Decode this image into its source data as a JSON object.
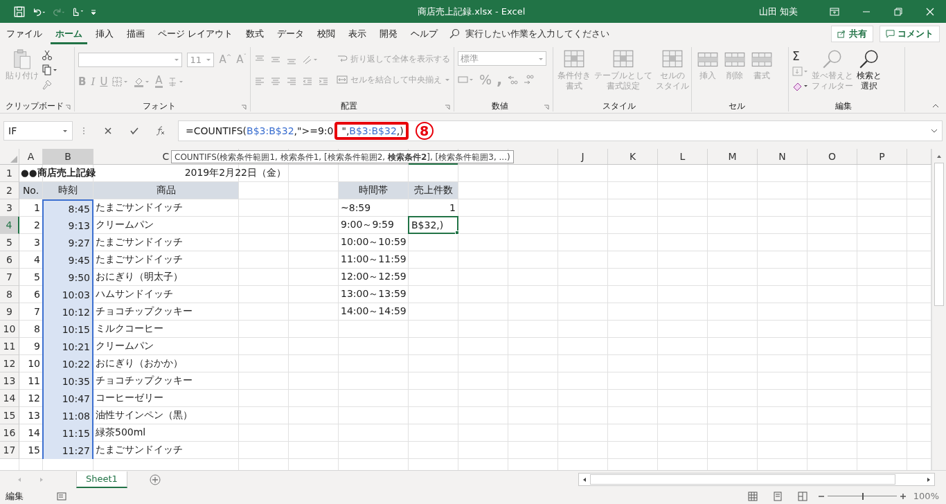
{
  "title_bar": {
    "title": "商店売上記録.xlsx  -  Excel",
    "user": "山田 知美"
  },
  "menu_tabs": [
    {
      "label": "ファイル",
      "selected": false
    },
    {
      "label": "ホーム",
      "selected": true
    },
    {
      "label": "挿入",
      "selected": false
    },
    {
      "label": "描画",
      "selected": false
    },
    {
      "label": "ページ レイアウト",
      "selected": false
    },
    {
      "label": "数式",
      "selected": false
    },
    {
      "label": "データ",
      "selected": false
    },
    {
      "label": "校閲",
      "selected": false
    },
    {
      "label": "表示",
      "selected": false
    },
    {
      "label": "開発",
      "selected": false
    },
    {
      "label": "ヘルプ",
      "selected": false
    }
  ],
  "tell_me": {
    "placeholder": "実行したい作業を入力してください"
  },
  "share_button": "共有",
  "comment_button": "コメント",
  "ribbon": {
    "clipboard": {
      "label": "クリップボード",
      "paste": {
        "label": "貼り付け",
        "disabled": true
      }
    },
    "font": {
      "label": "フォント",
      "font_size": "11",
      "size_buttons": [
        {
          "letter": "A",
          "arrow": "^"
        },
        {
          "letter": "A",
          "arrow": "ˇ"
        }
      ],
      "style_buttons": [
        "B",
        "I",
        "U"
      ],
      "color_button": "A"
    },
    "alignment": {
      "label": "配置",
      "wrap": "折り返して全体を表示する",
      "merge": "セルを結合して中央揃え"
    },
    "number": {
      "label": "数値",
      "format": "標準",
      "percent": "%",
      "comma": ","
    },
    "styles": {
      "label": "スタイル",
      "buttons": [
        {
          "lines": [
            "条件付き",
            "書式"
          ],
          "disabled": true
        },
        {
          "lines": [
            "テーブルとして",
            "書式設定"
          ],
          "disabled": true
        },
        {
          "lines": [
            "セルの",
            "スタイル"
          ],
          "disabled": true
        }
      ]
    },
    "cells": {
      "label": "セル",
      "buttons": [
        {
          "lines": [
            "挿入"
          ],
          "disabled": true
        },
        {
          "lines": [
            "削除"
          ],
          "disabled": true
        },
        {
          "lines": [
            "書式"
          ],
          "disabled": true
        }
      ]
    },
    "editing": {
      "label": "編集",
      "sum": "Σ",
      "buttons": [
        {
          "lines": [
            "並べ替えと",
            "フィルター"
          ],
          "disabled": true
        },
        {
          "lines": [
            "検索と",
            "選択"
          ],
          "disabled": false
        }
      ]
    }
  },
  "formula_bar": {
    "name_box": "IF",
    "segments": [
      {
        "text": "=COUNTIFS(",
        "kind": "plain"
      },
      {
        "text": "B$3:B$32",
        "kind": "ref"
      },
      {
        "text": ",\">=9:0",
        "kind": "plain"
      }
    ],
    "highlighted_segments": [
      {
        "text": "\",",
        "kind": "plain"
      },
      {
        "text": "B$3:B$32",
        "kind": "ref"
      },
      {
        "text": ",)",
        "kind": "plain"
      }
    ],
    "step_badge": "8"
  },
  "tooltip": "COUNTIFS(検索条件範囲1, 検索条件1, [検索条件範囲2, **検索条件2**], [検索条件範囲3, ...)",
  "column_headers": [
    "A",
    "B",
    "C",
    "J",
    "K",
    "L",
    "M",
    "N",
    "O",
    "P"
  ],
  "title_row": {
    "number": "1",
    "selected": false,
    "title": "●●商店売上記録",
    "date": "2019年2月22日（金）"
  },
  "rows": [
    {
      "number": "2",
      "kind": "header",
      "selected": false,
      "range": false,
      "g_active": false,
      "a": "No.",
      "b": "時刻",
      "c": "商品",
      "f": "時間帯",
      "g": "売上件数"
    },
    {
      "number": "3",
      "kind": "data",
      "selected": false,
      "range": true,
      "g_active": false,
      "a": "1",
      "b": "8:45",
      "c": "たまごサンドイッチ",
      "f": "~8:59",
      "g": "1"
    },
    {
      "number": "4",
      "kind": "data",
      "selected": true,
      "range": true,
      "g_active": true,
      "a": "2",
      "b": "9:13",
      "c": "クリームパン",
      "f": "9:00～9:59",
      "g": "B$32,)"
    },
    {
      "number": "5",
      "kind": "data",
      "selected": false,
      "range": true,
      "g_active": false,
      "a": "3",
      "b": "9:27",
      "c": "たまごサンドイッチ",
      "f": "10:00～10:59"
    },
    {
      "number": "6",
      "kind": "data",
      "selected": false,
      "range": true,
      "g_active": false,
      "a": "4",
      "b": "9:45",
      "c": "たまごサンドイッチ",
      "f": "11:00～11:59"
    },
    {
      "number": "7",
      "kind": "data",
      "selected": false,
      "range": true,
      "g_active": false,
      "a": "5",
      "b": "9:50",
      "c": "おにぎり（明太子）",
      "f": "12:00～12:59"
    },
    {
      "number": "8",
      "kind": "data",
      "selected": false,
      "range": true,
      "g_active": false,
      "a": "6",
      "b": "10:03",
      "c": "ハムサンドイッチ",
      "f": "13:00～13:59"
    },
    {
      "number": "9",
      "kind": "data",
      "selected": false,
      "range": true,
      "g_active": false,
      "a": "7",
      "b": "10:12",
      "c": "チョコチップクッキー",
      "f": "14:00～14:59"
    },
    {
      "number": "10",
      "kind": "data",
      "selected": false,
      "range": true,
      "g_active": false,
      "a": "8",
      "b": "10:15",
      "c": "ミルクコーヒー"
    },
    {
      "number": "11",
      "kind": "data",
      "selected": false,
      "range": true,
      "g_active": false,
      "a": "9",
      "b": "10:21",
      "c": "クリームパン"
    },
    {
      "number": "12",
      "kind": "data",
      "selected": false,
      "range": true,
      "g_active": false,
      "a": "10",
      "b": "10:22",
      "c": "おにぎり（おかか）"
    },
    {
      "number": "13",
      "kind": "data",
      "selected": false,
      "range": true,
      "g_active": false,
      "a": "11",
      "b": "10:35",
      "c": "チョコチップクッキー"
    },
    {
      "number": "14",
      "kind": "data",
      "selected": false,
      "range": true,
      "g_active": false,
      "a": "12",
      "b": "10:47",
      "c": "コーヒーゼリー"
    },
    {
      "number": "15",
      "kind": "data",
      "selected": false,
      "range": true,
      "g_active": false,
      "a": "13",
      "b": "11:08",
      "c": "油性サインペン（黒）"
    },
    {
      "number": "16",
      "kind": "data",
      "selected": false,
      "range": true,
      "g_active": false,
      "a": "14",
      "b": "11:15",
      "c": "緑茶500ml"
    },
    {
      "number": "17",
      "kind": "data",
      "selected": false,
      "range": true,
      "g_active": false,
      "a": "15",
      "b": "11:27",
      "c": "たまごサンドイッチ"
    }
  ],
  "sheet_tabs": [
    {
      "label": "Sheet1",
      "selected": true
    }
  ],
  "status_bar": {
    "mode": "編集",
    "zoom": "100%",
    "zoom_slider": {
      "level": 0.5
    }
  }
}
